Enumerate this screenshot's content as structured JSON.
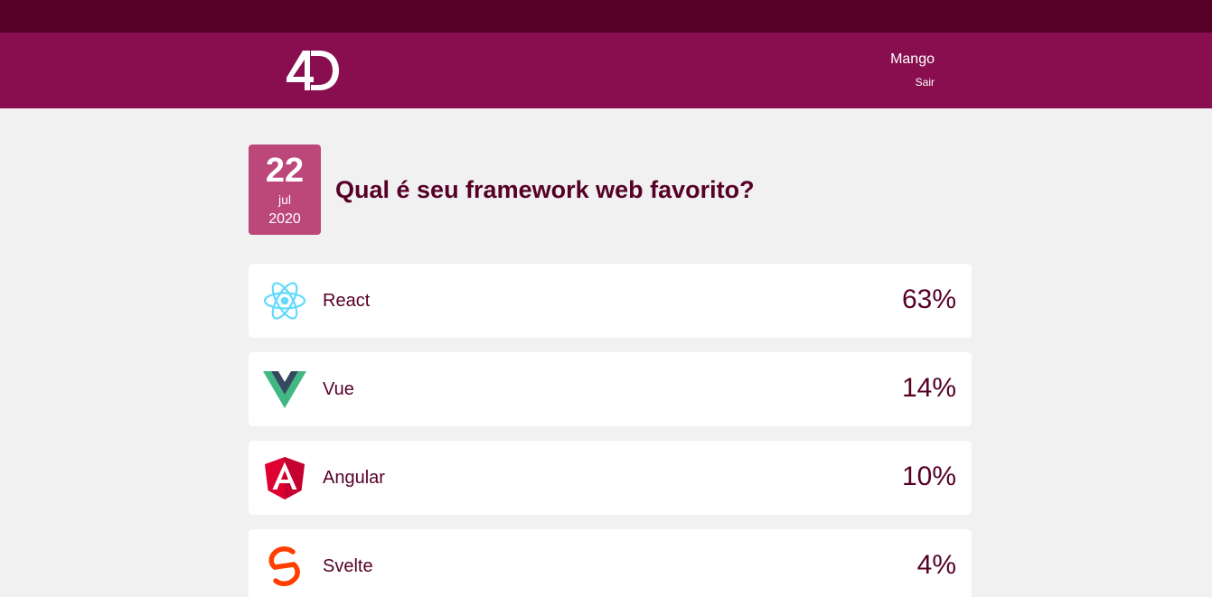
{
  "header": {
    "logo_text": "4D",
    "user_name": "Mango",
    "logout_label": "Sair"
  },
  "poll": {
    "date": {
      "day": "22",
      "month": "jul",
      "year": "2020"
    },
    "question": "Qual é seu framework web favorito?",
    "options": [
      {
        "label": "React",
        "percent": "63%",
        "icon": "react-icon"
      },
      {
        "label": "Vue",
        "percent": "14%",
        "icon": "vue-icon"
      },
      {
        "label": "Angular",
        "percent": "10%",
        "icon": "angular-icon"
      },
      {
        "label": "Svelte",
        "percent": "4%",
        "icon": "svelte-icon"
      }
    ]
  },
  "colors": {
    "topbar": "#560027",
    "header": "#880e4f",
    "date_badge": "#bc477b",
    "text": "#560027",
    "background": "#f1f1f1"
  }
}
